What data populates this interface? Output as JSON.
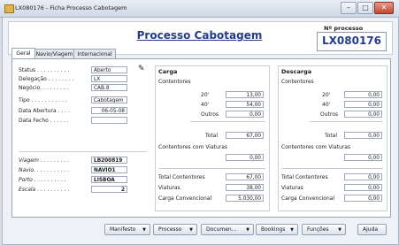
{
  "window": {
    "title": "LX080176 - Ficha Processo Cabotagem",
    "min": "–",
    "max": "□",
    "close": "✕"
  },
  "header": {
    "title": "Processo Cabotagem",
    "process_label": "Nº processo",
    "process_value": "LX080176"
  },
  "tabs": [
    {
      "label": "Geral"
    },
    {
      "label": "Navio/Viagem"
    },
    {
      "label": "Internacional"
    }
  ],
  "general": {
    "status": {
      "label": "Status . . . . . . . . . .",
      "value": "Aberto"
    },
    "delegacao": {
      "label": "Delegação . . . . . . . .",
      "value": "LX"
    },
    "negocio": {
      "label": "Negócio. . . . . . . . .",
      "value": "CAB.8"
    },
    "tipo": {
      "label": "Tipo . . . . . . . . . . .",
      "value": "Cabotagem"
    },
    "data_abertura": {
      "label": "Data Abertura . . . .",
      "value": "06-05-08"
    },
    "data_fecho": {
      "label": "Data Fecho . . . . . .",
      "value": ""
    },
    "viagem": {
      "label": "Viagem . . . . . . . . .",
      "value": "LB200819"
    },
    "navio": {
      "label": "Navio. . . . . . . . . . .",
      "value": "NAVIO1"
    },
    "porto": {
      "label": "Porto . . . . . . . . . .",
      "value": "LISBOA"
    },
    "escala": {
      "label": "Escala . . . . . . . . . .",
      "value": "2"
    }
  },
  "carga": {
    "title": "Carga",
    "contentores_label": "Contentores",
    "rows": [
      {
        "label": "20'",
        "value": "13,00"
      },
      {
        "label": "40'",
        "value": "54,00"
      },
      {
        "label": "Outros",
        "value": "0,00"
      }
    ],
    "total": {
      "label": "Total",
      "value": "67,00"
    },
    "viaturas_cont_label": "Contentores com Viaturas",
    "viaturas_cont_value": "0,00",
    "summary": [
      {
        "label": "Total Contentores",
        "value": "67,00"
      },
      {
        "label": "Viaturas",
        "value": "38,00"
      },
      {
        "label": "Carga Convencional",
        "value": "5.030,00"
      }
    ]
  },
  "descarga": {
    "title": "Descarga",
    "contentores_label": "Contentores",
    "rows": [
      {
        "label": "20'",
        "value": "0,00"
      },
      {
        "label": "40'",
        "value": "0,00"
      },
      {
        "label": "Outros",
        "value": "0,00"
      }
    ],
    "total": {
      "label": "Total",
      "value": "0,00"
    },
    "viaturas_cont_label": "Contentores com Viaturas",
    "viaturas_cont_value": "0,00",
    "summary": [
      {
        "label": "Total Contentores",
        "value": "0,00"
      },
      {
        "label": "Viaturas",
        "value": "0,00"
      },
      {
        "label": "Carga Convencional",
        "value": "0,00"
      }
    ]
  },
  "buttons": {
    "manifesto": "Manifesto",
    "processo": "Processo",
    "documentos": "Documen...",
    "bookings": "Bookings",
    "funcoes": "Funções",
    "ajuda": "Ajuda",
    "caret": "▼"
  }
}
